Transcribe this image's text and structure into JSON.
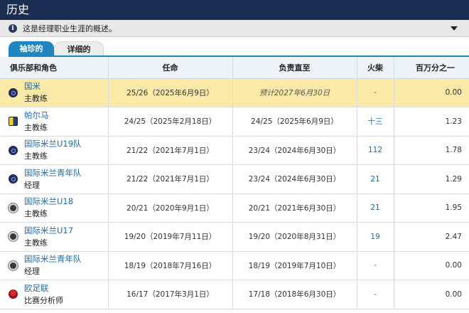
{
  "header": {
    "title": "历史"
  },
  "info": {
    "text": "这是经理职业生涯的概述。"
  },
  "tabs": [
    {
      "label": "袖珍的"
    },
    {
      "label": "详细的"
    }
  ],
  "columns": {
    "club_role": "俱乐部和角色",
    "appointed": "任命",
    "in_charge_until": "负责直至",
    "matches": "火柴",
    "ppm": "百万分之一"
  },
  "rows": [
    {
      "club": "国米",
      "role": "主教练",
      "appointed": "25/26（2025年6月9日）",
      "until": "预计2027年6月30日",
      "matches": "-",
      "ppm": "0.00",
      "logo": "inter"
    },
    {
      "club": "帕尔马",
      "role": "主教练",
      "appointed": "24/25（2025年2月18日）",
      "until": "24/25（2025年6月9日）",
      "matches": "十三",
      "ppm": "1.23",
      "logo": "parma"
    },
    {
      "club": "国际米兰U19队",
      "role": "主教练",
      "appointed": "21/22（2021年7月1日）",
      "until": "23/24（2024年6月30日）",
      "matches": "112",
      "ppm": "1.78",
      "logo": "inter"
    },
    {
      "club": "国际米兰青年队",
      "role": "经理",
      "appointed": "21/22（2021年7月1日）",
      "until": "23/24（2024年6月30日）",
      "matches": "21",
      "ppm": "1.29",
      "logo": "inter"
    },
    {
      "club": "国际米兰U18",
      "role": "主教练",
      "appointed": "20/21（2020年9月1日）",
      "until": "20/21（2021年6月30日）",
      "matches": "21",
      "ppm": "1.95",
      "logo": "youth"
    },
    {
      "club": "国际米兰U17",
      "role": "主教练",
      "appointed": "19/20（2019年7月11日）",
      "until": "19/20（2020年8月31日）",
      "matches": "19",
      "ppm": "2.47",
      "logo": "youth"
    },
    {
      "club": "国际米兰青年队",
      "role": "经理",
      "appointed": "18/19（2018年7月16日）",
      "until": "18/19（2019年7月10日）",
      "matches": "-",
      "ppm": "0.00",
      "logo": "youth"
    },
    {
      "club": "欧足联",
      "role": "比赛分析师",
      "appointed": "16/17（2017年3月1日）",
      "until": "17/18（2018年6月30日）",
      "matches": "-",
      "ppm": "0.00",
      "logo": "uefa"
    }
  ]
}
